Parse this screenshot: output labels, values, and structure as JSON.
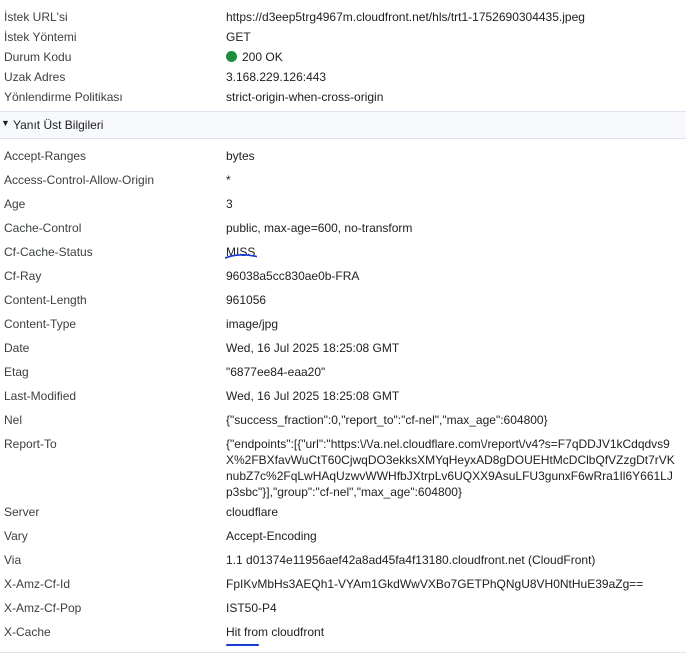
{
  "general": [
    {
      "key": "İstek URL'si",
      "value": "https://d3eep5trg4967m.cloudfront.net/hls/trt1-1752690304435.jpeg"
    },
    {
      "key": "İstek Yöntemi",
      "value": "GET"
    },
    {
      "key": "Durum Kodu",
      "value": "200 OK"
    },
    {
      "key": "Uzak Adres",
      "value": "3.168.229.126:443"
    },
    {
      "key": "Yönlendirme Politikası",
      "value": "strict-origin-when-cross-origin"
    }
  ],
  "status_color": "#1e8e3e",
  "response_headers_section": {
    "title": "Yanıt Üst Bilgileri",
    "expanded": true
  },
  "headers": [
    {
      "key": "Accept-Ranges",
      "value": "bytes"
    },
    {
      "key": "Access-Control-Allow-Origin",
      "value": "*"
    },
    {
      "key": "Age",
      "value": "3"
    },
    {
      "key": "Cache-Control",
      "value": "public, max-age=600, no-transform"
    },
    {
      "key": "Cf-Cache-Status",
      "value": "MISS"
    },
    {
      "key": "Cf-Ray",
      "value": "96038a5cc830ae0b-FRA"
    },
    {
      "key": "Content-Length",
      "value": "961056"
    },
    {
      "key": "Content-Type",
      "value": "image/jpg"
    },
    {
      "key": "Date",
      "value": "Wed, 16 Jul 2025 18:25:08 GMT"
    },
    {
      "key": "Etag",
      "value": "\"6877ee84-eaa20\""
    },
    {
      "key": "Last-Modified",
      "value": "Wed, 16 Jul 2025 18:25:08 GMT"
    },
    {
      "key": "Nel",
      "value": "{\"success_fraction\":0,\"report_to\":\"cf-nel\",\"max_age\":604800}"
    },
    {
      "key": "Report-To",
      "value": "{\"endpoints\":[{\"url\":\"https:\\/\\/a.nel.cloudflare.com\\/report\\/v4?s=F7qDDJV1kCdqdvs9X%2FBXfavWuCtT60CjwqDO3ekksXMYqHeyxAD8gDOUEHtMcDClbQfVZzgDt7rVKnubZ7c%2FqLwHAqUzwvWWHfbJXtrpLv6UQXX9AsuLFU3gunxF6wRra1Il6Y661LJp3sbc\"}],\"group\":\"cf-nel\",\"max_age\":604800}"
    },
    {
      "key": "Server",
      "value": "cloudflare"
    },
    {
      "key": "Vary",
      "value": "Accept-Encoding"
    },
    {
      "key": "Via",
      "value": "1.1 d01374e11956aef42a8ad45fa4f13180.cloudfront.net (CloudFront)"
    },
    {
      "key": "X-Amz-Cf-Id",
      "value": "FpIKvMbHs3AEQh1-VYAm1GkdWwVXBo7GETPhQNgU8VH0NtHuE39aZg=="
    },
    {
      "key": "X-Amz-Cf-Pop",
      "value": "IST50-P4"
    },
    {
      "key": "X-Cache",
      "value": "Hit from cloudfront"
    }
  ],
  "annotation_color": "#1a3ad6"
}
